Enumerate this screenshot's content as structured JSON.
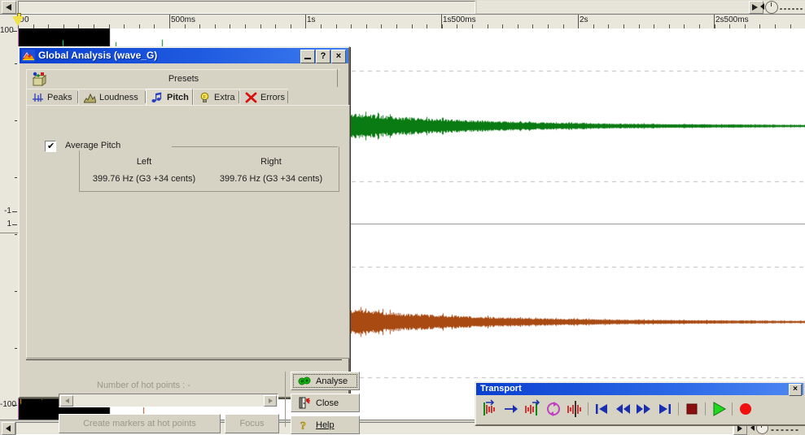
{
  "app": {
    "ruler": {
      "labels": [
        "0",
        "500ms",
        "1s",
        "1s500ms",
        "2s",
        "2s500ms"
      ],
      "positions": [
        0,
        186,
        353,
        520,
        688,
        855
      ]
    },
    "vertical_axis": {
      "top_label": "100",
      "mid_upper_label": "-1",
      "mid_lower_label": "1",
      "bottom_label": "-100"
    },
    "waveform": {
      "top_channel_color": "#0a7a12",
      "top_channel_selected_color": "#34f59a",
      "bottom_channel_color": "#a84a12",
      "bottom_channel_selected_color": "#ffa424",
      "selection_background": "#000000"
    }
  },
  "dialog": {
    "title": "Global Analysis (wave_G)",
    "title_icon": "analysis-mountain-icon",
    "buttons": {
      "minimize": "",
      "help": "?",
      "close": "×"
    },
    "presets": {
      "label": "Presets",
      "icon": "presets-box-icon"
    },
    "tabs": [
      {
        "label": "Peaks",
        "icon": "peaks-icon",
        "active": false
      },
      {
        "label": "Loudness",
        "icon": "loudness-icon",
        "active": false
      },
      {
        "label": "Pitch",
        "icon": "pitch-notes-icon",
        "active": true
      },
      {
        "label": "Extra",
        "icon": "lightbulb-icon",
        "active": false
      },
      {
        "label": "Errors",
        "icon": "red-x-icon",
        "active": false
      }
    ],
    "pitch_panel": {
      "group_label": "Average Pitch",
      "checkbox_checked": true,
      "columns": [
        "Left",
        "Right"
      ],
      "values": [
        "399.76 Hz (G3 +34 cents)",
        "399.76 Hz (G3 +34 cents)"
      ]
    },
    "footer": {
      "hot_points_label": "Number of hot points :  -",
      "create_markers_label": "Create markers at hot points",
      "focus_label": "Focus",
      "analyse_label": "Analyse",
      "analyse_icon": "green-gears-icon",
      "close_label": "Close",
      "close_icon": "exit-door-icon",
      "help_label": "Help",
      "help_icon": "yellow-question-icon"
    }
  },
  "transport": {
    "title": "Transport",
    "close_label": "×",
    "buttons": [
      {
        "name": "marker-set-start",
        "icon": "marker-start-icon"
      },
      {
        "name": "marker-goto",
        "icon": "marker-goto-icon"
      },
      {
        "name": "marker-set-end",
        "icon": "marker-end-icon"
      },
      {
        "name": "loop-playback",
        "icon": "loop-icon"
      },
      {
        "name": "snap-to-zero",
        "icon": "snap-zero-icon"
      },
      {
        "name": "go-to-start",
        "icon": "skip-back-icon"
      },
      {
        "name": "rewind",
        "icon": "rewind-icon"
      },
      {
        "name": "fast-forward",
        "icon": "fast-forward-icon"
      },
      {
        "name": "go-to-end",
        "icon": "skip-forward-icon"
      },
      {
        "name": "stop",
        "icon": "stop-icon"
      },
      {
        "name": "play",
        "icon": "play-icon"
      },
      {
        "name": "record",
        "icon": "record-icon"
      }
    ]
  }
}
